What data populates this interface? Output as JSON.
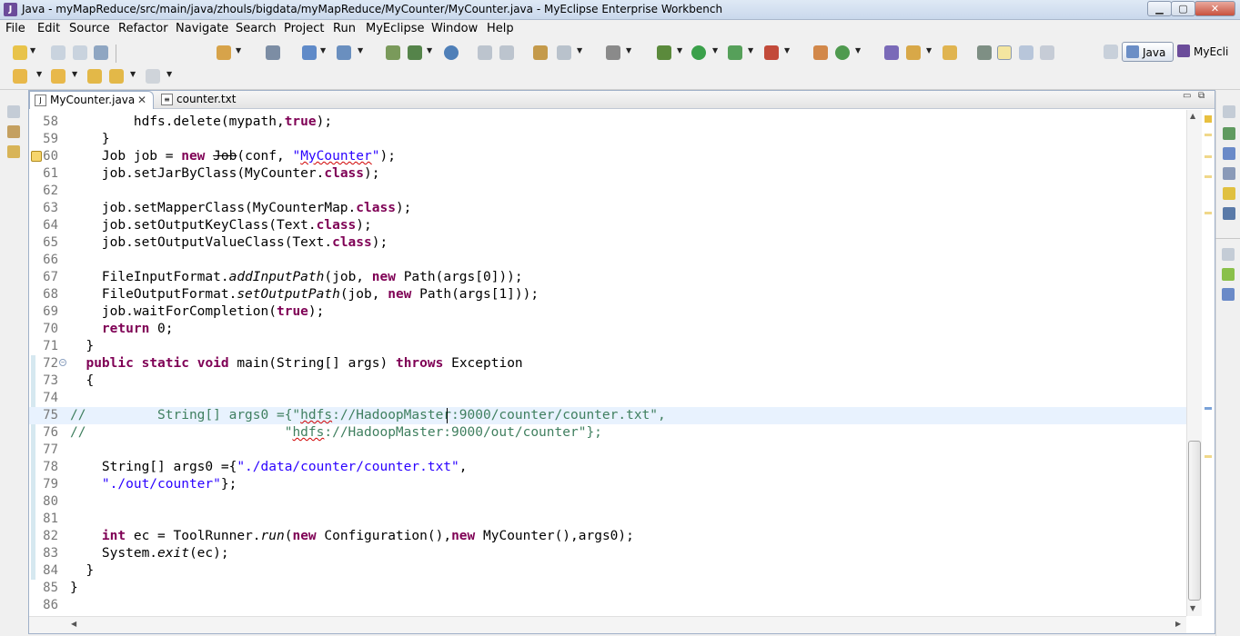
{
  "window": {
    "title": "Java - myMapReduce/src/main/java/zhouls/bigdata/myMapReduce/MyCounter/MyCounter.java - MyEclipse Enterprise Workbench"
  },
  "menu": [
    "File",
    "Edit",
    "Source",
    "Refactor",
    "Navigate",
    "Search",
    "Project",
    "Run",
    "MyEclipse",
    "Window",
    "Help"
  ],
  "perspectives": {
    "java": "Java",
    "myecli": "MyEcli"
  },
  "tabs": [
    {
      "label": "MyCounter.java",
      "active": true,
      "close": "✕"
    },
    {
      "label": "counter.txt",
      "active": false
    }
  ],
  "lines": [
    {
      "n": "58",
      "tokens": [
        [
          "",
          "        hdfs.delete(mypath,"
        ],
        [
          "kw",
          "true"
        ],
        [
          "",
          ");"
        ]
      ]
    },
    {
      "n": "59",
      "tokens": [
        [
          "",
          "    }"
        ]
      ]
    },
    {
      "n": "60",
      "warn": true,
      "tokens": [
        [
          "",
          "    Job job = "
        ],
        [
          "kw",
          "new"
        ],
        [
          "",
          " "
        ],
        [
          "strike",
          "Job"
        ],
        [
          "",
          "(conf, "
        ],
        [
          "str",
          "\""
        ],
        [
          "str squig",
          "MyCounter"
        ],
        [
          "str",
          "\""
        ],
        [
          "",
          ");"
        ]
      ]
    },
    {
      "n": "61",
      "tokens": [
        [
          "",
          "    job.setJarByClass(MyCounter."
        ],
        [
          "kw",
          "class"
        ],
        [
          "",
          ");"
        ]
      ]
    },
    {
      "n": "62",
      "tokens": [
        [
          "",
          ""
        ]
      ]
    },
    {
      "n": "63",
      "tokens": [
        [
          "",
          "    job.setMapperClass(MyCounterMap."
        ],
        [
          "kw",
          "class"
        ],
        [
          "",
          ");"
        ]
      ]
    },
    {
      "n": "64",
      "tokens": [
        [
          "",
          "    job.setOutputKeyClass(Text."
        ],
        [
          "kw",
          "class"
        ],
        [
          "",
          ");"
        ]
      ]
    },
    {
      "n": "65",
      "tokens": [
        [
          "",
          "    job.setOutputValueClass(Text."
        ],
        [
          "kw",
          "class"
        ],
        [
          "",
          ");"
        ]
      ]
    },
    {
      "n": "66",
      "tokens": [
        [
          "",
          ""
        ]
      ]
    },
    {
      "n": "67",
      "tokens": [
        [
          "",
          "    FileInputFormat."
        ],
        [
          "it",
          "addInputPath"
        ],
        [
          "",
          "(job, "
        ],
        [
          "kw",
          "new"
        ],
        [
          "",
          " Path(args[0]));"
        ]
      ]
    },
    {
      "n": "68",
      "tokens": [
        [
          "",
          "    FileOutputFormat."
        ],
        [
          "it",
          "setOutputPath"
        ],
        [
          "",
          "(job, "
        ],
        [
          "kw",
          "new"
        ],
        [
          "",
          " Path(args[1]));"
        ]
      ]
    },
    {
      "n": "69",
      "tokens": [
        [
          "",
          "    job.waitForCompletion("
        ],
        [
          "kw",
          "true"
        ],
        [
          "",
          ");"
        ]
      ]
    },
    {
      "n": "70",
      "tokens": [
        [
          "",
          "    "
        ],
        [
          "kw",
          "return"
        ],
        [
          "",
          " 0;"
        ]
      ]
    },
    {
      "n": "71",
      "tokens": [
        [
          "",
          "  }"
        ]
      ]
    },
    {
      "n": "72",
      "fold": true,
      "tokens": [
        [
          "",
          "  "
        ],
        [
          "kw",
          "public"
        ],
        [
          "",
          " "
        ],
        [
          "kw",
          "static"
        ],
        [
          "",
          " "
        ],
        [
          "kw",
          "void"
        ],
        [
          "",
          " main(String[] args) "
        ],
        [
          "kw",
          "throws"
        ],
        [
          "",
          " Exception"
        ]
      ]
    },
    {
      "n": "73",
      "tokens": [
        [
          "",
          "  {"
        ]
      ]
    },
    {
      "n": "74",
      "tokens": [
        [
          "",
          ""
        ]
      ]
    },
    {
      "n": "75",
      "current": true,
      "tokens": [
        [
          "cmt",
          "//         String[] args0 ={\""
        ],
        [
          "cmt squig",
          "hdfs"
        ],
        [
          "cmt",
          "://HadoopMaster:9000/counter/counter.txt\","
        ]
      ]
    },
    {
      "n": "76",
      "tokens": [
        [
          "cmt",
          "//                         \""
        ],
        [
          "cmt squig",
          "hdfs"
        ],
        [
          "cmt",
          "://HadoopMaster:9000/out/counter\"};"
        ]
      ]
    },
    {
      "n": "77",
      "tokens": [
        [
          "",
          ""
        ]
      ]
    },
    {
      "n": "78",
      "tokens": [
        [
          "",
          "    String[] args0 ={"
        ],
        [
          "str",
          "\"./data/counter/counter.txt\""
        ],
        [
          "",
          ","
        ]
      ]
    },
    {
      "n": "79",
      "tokens": [
        [
          "",
          "    "
        ],
        [
          "str",
          "\"./out/counter\""
        ],
        [
          "",
          "};"
        ]
      ]
    },
    {
      "n": "80",
      "tokens": [
        [
          "",
          ""
        ]
      ]
    },
    {
      "n": "81",
      "tokens": [
        [
          "",
          ""
        ]
      ]
    },
    {
      "n": "82",
      "tokens": [
        [
          "",
          "    "
        ],
        [
          "kw",
          "int"
        ],
        [
          "",
          " ec = ToolRunner."
        ],
        [
          "it",
          "run"
        ],
        [
          "",
          "("
        ],
        [
          "kw",
          "new"
        ],
        [
          "",
          " Configuration(),"
        ],
        [
          "kw",
          "new"
        ],
        [
          "",
          " MyCounter(),args0);"
        ]
      ]
    },
    {
      "n": "83",
      "tokens": [
        [
          "",
          "    System."
        ],
        [
          "it",
          "exit"
        ],
        [
          "",
          "(ec);"
        ]
      ]
    },
    {
      "n": "84",
      "tokens": [
        [
          "",
          "  }"
        ]
      ]
    },
    {
      "n": "85",
      "tokens": [
        [
          "",
          "}"
        ]
      ]
    },
    {
      "n": "86",
      "tokens": [
        [
          "",
          ""
        ]
      ]
    }
  ]
}
